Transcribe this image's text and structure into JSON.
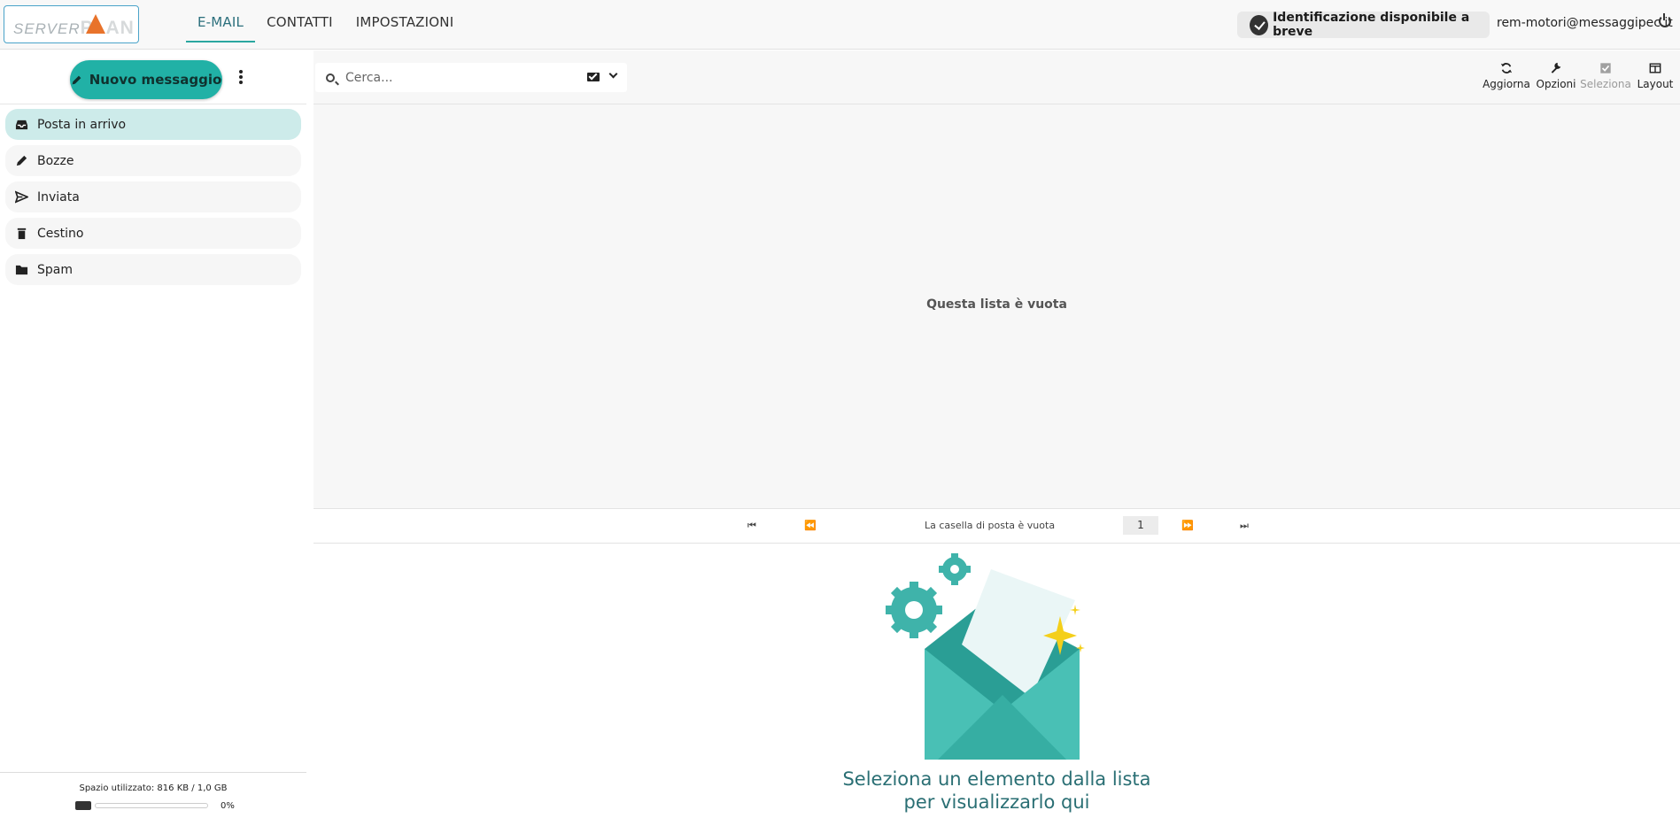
{
  "header": {
    "logo": {
      "part1": "SERVER",
      "part2": "PLAN"
    },
    "nav": [
      {
        "label": "E-MAIL",
        "active": true
      },
      {
        "label": "CONTATTI",
        "active": false
      },
      {
        "label": "IMPOSTAZIONI",
        "active": false
      }
    ],
    "identification_label": "Identificazione disponibile a breve",
    "user_email": "rem-motori@messaggipec.it"
  },
  "sidebar": {
    "compose_label": "Nuovo messaggio",
    "folders": [
      {
        "label": "Posta in arrivo",
        "icon": "inbox-icon",
        "active": true
      },
      {
        "label": "Bozze",
        "icon": "pencil-icon",
        "active": false
      },
      {
        "label": "Inviata",
        "icon": "send-icon",
        "active": false
      },
      {
        "label": "Cestino",
        "icon": "trash-icon",
        "active": false
      },
      {
        "label": "Spam",
        "icon": "folder-icon",
        "active": false
      }
    ],
    "quota": {
      "text": "Spazio utilizzato: 816 KB / 1,0 GB",
      "percent_label": "0%",
      "fraction": 0.0
    }
  },
  "toolbar": {
    "search_placeholder": "Cerca...",
    "tools": [
      {
        "label": "Aggiorna",
        "icon": "refresh-icon",
        "disabled": false
      },
      {
        "label": "Opzioni",
        "icon": "wrench-icon",
        "disabled": false
      },
      {
        "label": "Seleziona",
        "icon": "checkbox-icon",
        "disabled": true
      },
      {
        "label": "Layout",
        "icon": "layout-icon",
        "disabled": false
      }
    ]
  },
  "list": {
    "empty_message": "Questa lista è vuota"
  },
  "pager": {
    "status_text": "La casella di posta è vuota",
    "page": "1"
  },
  "preview": {
    "line1": "Seleziona un elemento dalla lista",
    "line2": "per visualizzarlo qui"
  },
  "colors": {
    "accent": "#21b1a6",
    "active_folder": "#cdebea",
    "nav_active": "#2b6f7c"
  }
}
